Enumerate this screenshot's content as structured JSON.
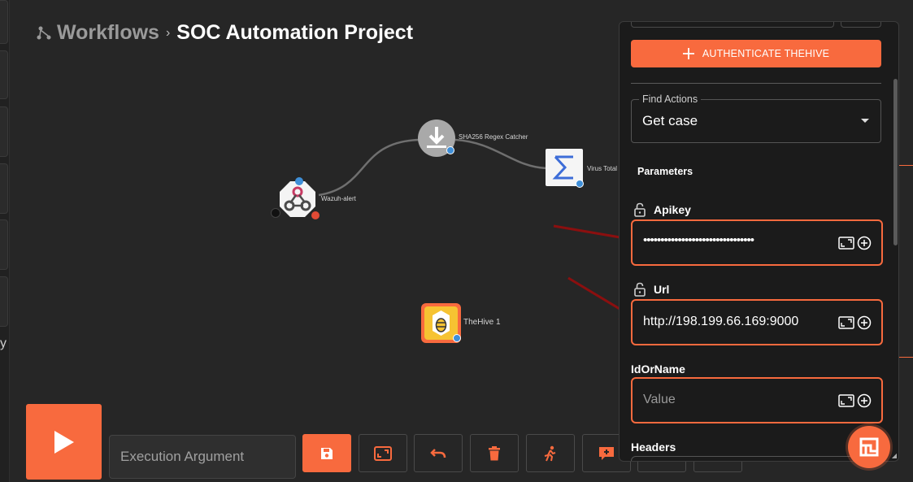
{
  "breadcrumb": {
    "root": "Workflows",
    "separator": "›",
    "current": "SOC Automation Project"
  },
  "left_rail": {
    "truncated_text": "y"
  },
  "canvas": {
    "nodes": [
      {
        "id": "wazuh",
        "label": "Wazuh-alert",
        "icon": "webhook-icon"
      },
      {
        "id": "sha",
        "label": "SHA256 Regex Catcher",
        "icon": "download-icon"
      },
      {
        "id": "vt",
        "label": "Virus Total",
        "icon": "sigma-icon"
      },
      {
        "id": "hive",
        "label": "TheHive 1",
        "icon": "bee-icon"
      }
    ]
  },
  "toolbar": {
    "execution_placeholder": "Execution Argument",
    "buttons": [
      "save-icon",
      "fullscreen-icon",
      "undo-icon",
      "delete-icon",
      "run-person-icon",
      "add-comment-icon"
    ]
  },
  "panel": {
    "auth_button": "AUTHENTICATE THEHIVE",
    "find_actions_label": "Find Actions",
    "find_actions_value": "Get case",
    "parameters_title": "Parameters",
    "fields": {
      "apikey": {
        "label": "Apikey",
        "value": "••••••••••••••••••••••••••••••••"
      },
      "url": {
        "label": "Url",
        "value": "http://198.199.66.169:9000"
      },
      "idorname": {
        "label": "IdOrName",
        "placeholder": "Value"
      },
      "headers": {
        "label": "Headers"
      }
    }
  },
  "colors": {
    "accent": "#f86a3e",
    "background": "#262626",
    "panel": "#1b1b1b",
    "arrow": "#8b0f0f"
  }
}
